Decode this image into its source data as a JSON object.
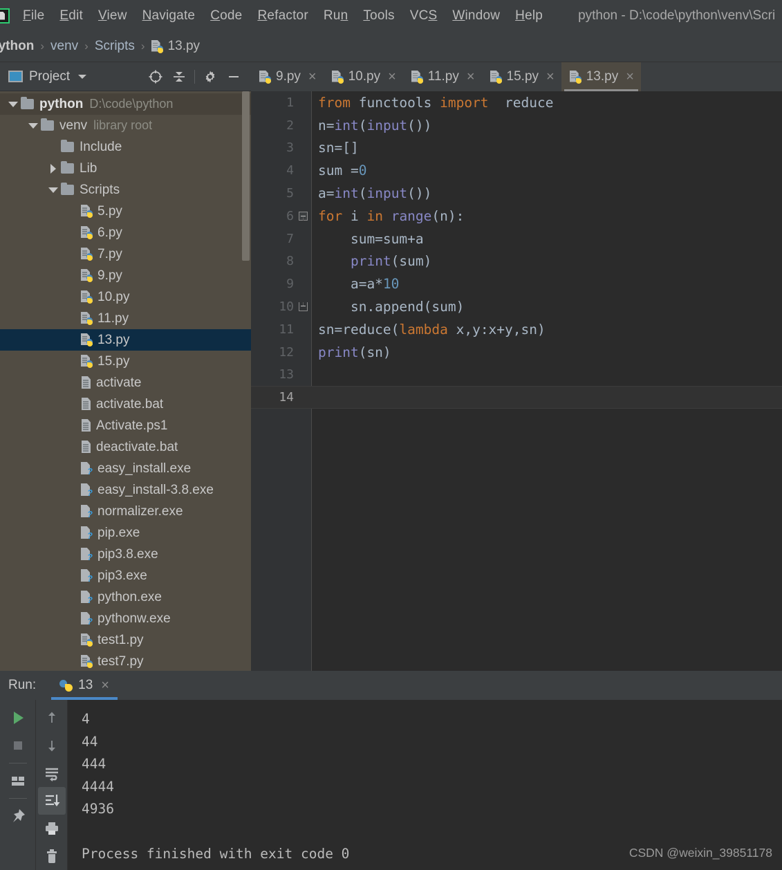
{
  "window": {
    "title": "python - D:\\code\\python\\venv\\Scri",
    "app_icon": "pycharm-icon"
  },
  "menubar": {
    "items": [
      {
        "label": "File",
        "mnemonic": "F"
      },
      {
        "label": "Edit",
        "mnemonic": "E"
      },
      {
        "label": "View",
        "mnemonic": "V"
      },
      {
        "label": "Navigate",
        "mnemonic": "N"
      },
      {
        "label": "Code",
        "mnemonic": "C"
      },
      {
        "label": "Refactor",
        "mnemonic": "R"
      },
      {
        "label": "Run",
        "mnemonic": "n"
      },
      {
        "label": "Tools",
        "mnemonic": "T"
      },
      {
        "label": "VCS",
        "mnemonic": "S"
      },
      {
        "label": "Window",
        "mnemonic": "W"
      },
      {
        "label": "Help",
        "mnemonic": "H"
      }
    ]
  },
  "breadcrumb": {
    "items": [
      "python",
      "venv",
      "Scripts",
      "13.py"
    ],
    "separator": "›"
  },
  "project_panel": {
    "title": "Project",
    "dropdown_caret": "chevron-down-icon",
    "tools": [
      {
        "name": "locate-icon"
      },
      {
        "name": "collapse-all-icon"
      },
      {
        "name": "gear-icon"
      },
      {
        "name": "minimize-icon"
      }
    ],
    "tree": [
      {
        "label": "python",
        "sub": "D:\\code\\python",
        "kind": "folder",
        "arrow": "down",
        "indent": 0,
        "bold": true,
        "root": true
      },
      {
        "label": "venv",
        "sub": "library root",
        "kind": "folder",
        "arrow": "down",
        "indent": 1
      },
      {
        "label": "Include",
        "sub": "",
        "kind": "folder",
        "arrow": "none",
        "indent": 2
      },
      {
        "label": "Lib",
        "sub": "",
        "kind": "folder",
        "arrow": "right",
        "indent": 2
      },
      {
        "label": "Scripts",
        "sub": "",
        "kind": "folder",
        "arrow": "down",
        "indent": 2
      },
      {
        "label": "5.py",
        "sub": "",
        "kind": "py",
        "arrow": "none",
        "indent": 3
      },
      {
        "label": "6.py",
        "sub": "",
        "kind": "py",
        "arrow": "none",
        "indent": 3
      },
      {
        "label": "7.py",
        "sub": "",
        "kind": "py",
        "arrow": "none",
        "indent": 3
      },
      {
        "label": "9.py",
        "sub": "",
        "kind": "py",
        "arrow": "none",
        "indent": 3
      },
      {
        "label": "10.py",
        "sub": "",
        "kind": "py",
        "arrow": "none",
        "indent": 3
      },
      {
        "label": "11.py",
        "sub": "",
        "kind": "py",
        "arrow": "none",
        "indent": 3
      },
      {
        "label": "13.py",
        "sub": "",
        "kind": "py",
        "arrow": "none",
        "indent": 3,
        "selected": true
      },
      {
        "label": "15.py",
        "sub": "",
        "kind": "py",
        "arrow": "none",
        "indent": 3
      },
      {
        "label": "activate",
        "sub": "",
        "kind": "doc",
        "arrow": "none",
        "indent": 3
      },
      {
        "label": "activate.bat",
        "sub": "",
        "kind": "doc",
        "arrow": "none",
        "indent": 3
      },
      {
        "label": "Activate.ps1",
        "sub": "",
        "kind": "doc",
        "arrow": "none",
        "indent": 3
      },
      {
        "label": "deactivate.bat",
        "sub": "",
        "kind": "doc",
        "arrow": "none",
        "indent": 3
      },
      {
        "label": "easy_install.exe",
        "sub": "",
        "kind": "exe",
        "arrow": "none",
        "indent": 3
      },
      {
        "label": "easy_install-3.8.exe",
        "sub": "",
        "kind": "exe",
        "arrow": "none",
        "indent": 3
      },
      {
        "label": "normalizer.exe",
        "sub": "",
        "kind": "exe",
        "arrow": "none",
        "indent": 3
      },
      {
        "label": "pip.exe",
        "sub": "",
        "kind": "exe",
        "arrow": "none",
        "indent": 3
      },
      {
        "label": "pip3.8.exe",
        "sub": "",
        "kind": "exe",
        "arrow": "none",
        "indent": 3
      },
      {
        "label": "pip3.exe",
        "sub": "",
        "kind": "exe",
        "arrow": "none",
        "indent": 3
      },
      {
        "label": "python.exe",
        "sub": "",
        "kind": "exe",
        "arrow": "none",
        "indent": 3
      },
      {
        "label": "pythonw.exe",
        "sub": "",
        "kind": "exe",
        "arrow": "none",
        "indent": 3
      },
      {
        "label": "test1.py",
        "sub": "",
        "kind": "py",
        "arrow": "none",
        "indent": 3
      },
      {
        "label": "test7.py",
        "sub": "",
        "kind": "py",
        "arrow": "none",
        "indent": 3
      }
    ]
  },
  "editor": {
    "tabs": [
      {
        "label": "9.py",
        "active": false,
        "close": "×"
      },
      {
        "label": "10.py",
        "active": false,
        "close": "×"
      },
      {
        "label": "11.py",
        "active": false,
        "close": "×"
      },
      {
        "label": "15.py",
        "active": false,
        "close": "×"
      },
      {
        "label": "13.py",
        "active": true,
        "close": "×"
      }
    ],
    "lines": [
      {
        "n": "1",
        "fold": "none",
        "tokens": [
          {
            "t": "from",
            "c": "kw"
          },
          {
            "t": " functools ",
            "c": "pl"
          },
          {
            "t": "import",
            "c": "kw"
          },
          {
            "t": "  reduce",
            "c": "pl"
          }
        ]
      },
      {
        "n": "2",
        "fold": "none",
        "tokens": [
          {
            "t": "n=",
            "c": "pl"
          },
          {
            "t": "int",
            "c": "bi"
          },
          {
            "t": "(",
            "c": "pl"
          },
          {
            "t": "input",
            "c": "bi"
          },
          {
            "t": "())",
            "c": "pl"
          }
        ]
      },
      {
        "n": "3",
        "fold": "none",
        "tokens": [
          {
            "t": "sn=[]",
            "c": "pl"
          }
        ]
      },
      {
        "n": "4",
        "fold": "none",
        "tokens": [
          {
            "t": "sum =",
            "c": "pl"
          },
          {
            "t": "0",
            "c": "num"
          }
        ]
      },
      {
        "n": "5",
        "fold": "none",
        "tokens": [
          {
            "t": "a=",
            "c": "pl"
          },
          {
            "t": "int",
            "c": "bi"
          },
          {
            "t": "(",
            "c": "pl"
          },
          {
            "t": "input",
            "c": "bi"
          },
          {
            "t": "())",
            "c": "pl"
          }
        ]
      },
      {
        "n": "6",
        "fold": "start",
        "tokens": [
          {
            "t": "for",
            "c": "kw"
          },
          {
            "t": " i ",
            "c": "pl"
          },
          {
            "t": "in",
            "c": "kw"
          },
          {
            "t": " ",
            "c": "pl"
          },
          {
            "t": "range",
            "c": "bi"
          },
          {
            "t": "(n):",
            "c": "pl"
          }
        ]
      },
      {
        "n": "7",
        "fold": "mid",
        "tokens": [
          {
            "t": "    sum=sum+a",
            "c": "pl"
          }
        ]
      },
      {
        "n": "8",
        "fold": "mid",
        "tokens": [
          {
            "t": "    ",
            "c": "pl"
          },
          {
            "t": "print",
            "c": "bi"
          },
          {
            "t": "(sum)",
            "c": "pl"
          }
        ]
      },
      {
        "n": "9",
        "fold": "mid",
        "tokens": [
          {
            "t": "    a=a*",
            "c": "pl"
          },
          {
            "t": "10",
            "c": "num"
          }
        ]
      },
      {
        "n": "10",
        "fold": "end",
        "tokens": [
          {
            "t": "    sn.append(sum)",
            "c": "pl"
          }
        ]
      },
      {
        "n": "11",
        "fold": "none",
        "tokens": [
          {
            "t": "sn=reduce(",
            "c": "pl"
          },
          {
            "t": "lambda",
            "c": "kw"
          },
          {
            "t": " x,y:x+y,sn)",
            "c": "pl"
          }
        ]
      },
      {
        "n": "12",
        "fold": "none",
        "tokens": [
          {
            "t": "print",
            "c": "bi"
          },
          {
            "t": "(sn)",
            "c": "pl"
          }
        ]
      },
      {
        "n": "13",
        "fold": "none",
        "tokens": [
          {
            "t": "",
            "c": "pl"
          }
        ]
      },
      {
        "n": "14",
        "fold": "none",
        "caret": true,
        "tokens": [
          {
            "t": "",
            "c": "pl"
          }
        ]
      }
    ]
  },
  "run_panel": {
    "label": "Run:",
    "tab": {
      "label": "13",
      "icon": "python-icon",
      "close": "×"
    },
    "toolbar_left": [
      {
        "name": "rerun-icon"
      },
      {
        "name": "stop-icon"
      },
      {
        "name": "layout-icon"
      },
      {
        "name": "pin-icon"
      }
    ],
    "toolbar_right": [
      {
        "name": "up-arrow-icon"
      },
      {
        "name": "down-arrow-icon"
      },
      {
        "name": "soft-wrap-icon"
      },
      {
        "name": "scroll-to-end-icon",
        "active": true
      },
      {
        "name": "print-icon"
      },
      {
        "name": "trash-icon"
      }
    ],
    "console": [
      "4",
      "44",
      "444",
      "4444",
      "4936",
      "",
      "Process finished with exit code 0"
    ]
  },
  "watermark": "CSDN @weixin_39851178",
  "colors": {
    "editor_bg": "#2b2b2b",
    "chrome_bg": "#3c3f41",
    "project_bg": "#514c43",
    "selection": "#0d2c44",
    "keyword": "#cc7832",
    "builtin": "#8888c6",
    "number": "#6897bb",
    "text": "#a9b7c6",
    "accent": "#4a88c7"
  }
}
